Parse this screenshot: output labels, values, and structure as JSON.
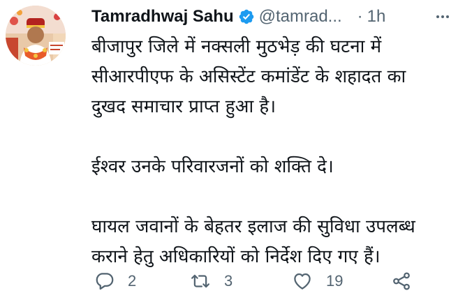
{
  "tweet": {
    "author_name": "Tamradhwaj Sahu",
    "handle": "@tamrad...",
    "separator": "·",
    "time": "1h",
    "lines": [
      "बीजापुर जिले में नक्सली मुठभेड़ की घटना में",
      "सीआरपीएफ के असिस्टेंट कमांडेंट के शहादत का",
      "दुखद समाचार प्राप्त हुआ है।",
      "",
      "ईश्वर उनके परिवारजनों को शक्ति दे।",
      "",
      "घायल जवानों के बेहतर इलाज की सुविधा उपलब्ध",
      "कराने हेतु अधिकारियों को निर्देश दिए गए हैं।"
    ]
  },
  "actions": {
    "reply_count": "2",
    "retweet_count": "3",
    "like_count": "19"
  },
  "icons": {
    "verified": "verified-badge-icon",
    "more": "more-options-icon",
    "reply": "reply-icon",
    "retweet": "retweet-icon",
    "like": "like-icon",
    "share": "share-icon"
  },
  "colors": {
    "text": "#0f1419",
    "secondary": "#536471",
    "verified": "#1d9bf0"
  }
}
